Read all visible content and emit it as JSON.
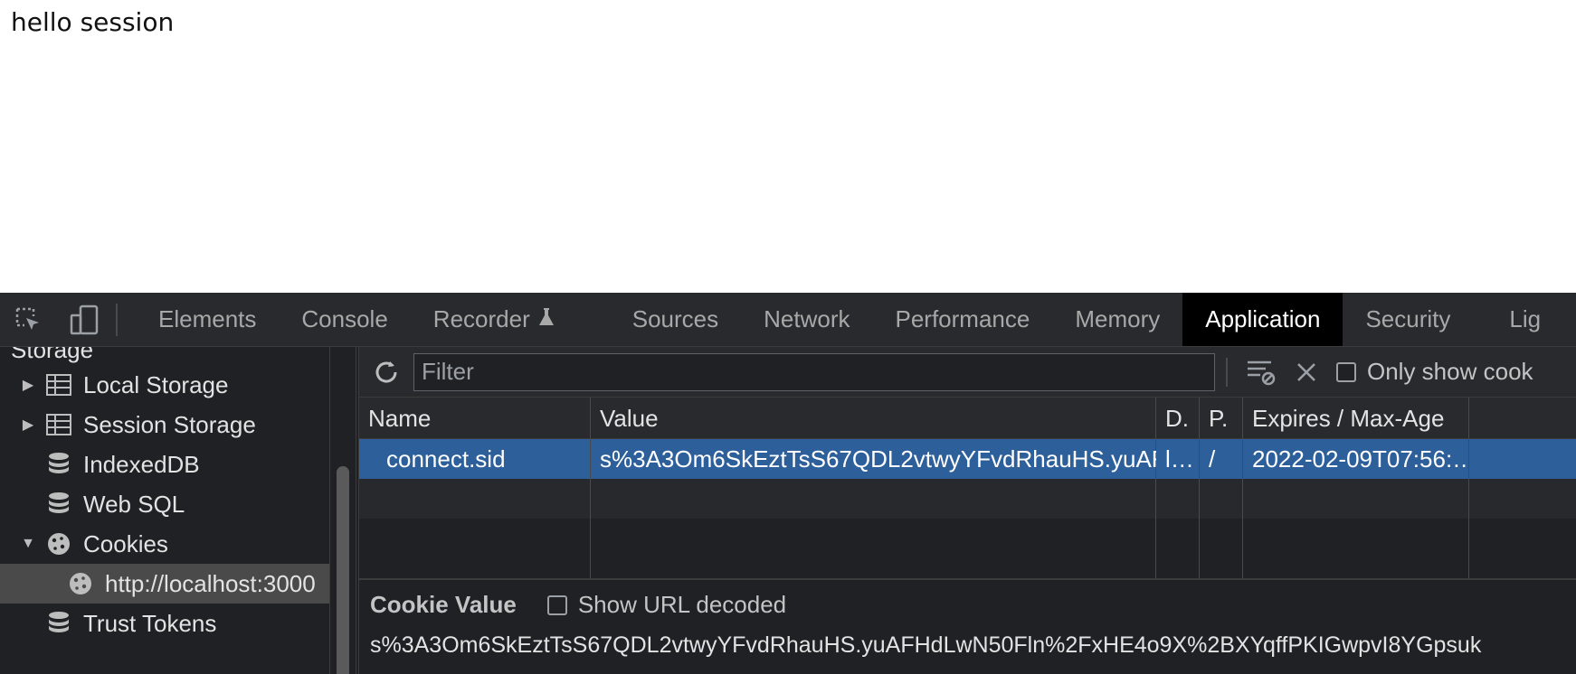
{
  "page": {
    "heading": "hello session"
  },
  "devtools": {
    "tabs": [
      {
        "label": "Elements"
      },
      {
        "label": "Console"
      },
      {
        "label": "Recorder"
      },
      {
        "label": "Sources"
      },
      {
        "label": "Network"
      },
      {
        "label": "Performance"
      },
      {
        "label": "Memory"
      },
      {
        "label": "Application"
      },
      {
        "label": "Security"
      },
      {
        "label": "Lig"
      }
    ],
    "active_tab": "Application",
    "sidebar": {
      "section_title": "Storage",
      "items": [
        {
          "label": "Local Storage",
          "icon": "table-icon",
          "expandable": true
        },
        {
          "label": "Session Storage",
          "icon": "table-icon",
          "expandable": true
        },
        {
          "label": "IndexedDB",
          "icon": "database-icon",
          "expandable": false
        },
        {
          "label": "Web SQL",
          "icon": "database-icon",
          "expandable": false
        },
        {
          "label": "Cookies",
          "icon": "cookie-icon",
          "expandable": true,
          "expanded": true
        },
        {
          "label": "http://localhost:3000",
          "icon": "cookie-icon",
          "selected": true
        },
        {
          "label": "Trust Tokens",
          "icon": "database-icon",
          "expandable": false
        }
      ]
    },
    "toolbar": {
      "filter_placeholder": "Filter",
      "only_show_label": "Only show cook"
    },
    "table": {
      "headers": {
        "name": "Name",
        "value": "Value",
        "domain": "D.",
        "path": "P.",
        "expires": "Expires / Max-Age"
      },
      "rows": [
        {
          "name": "connect.sid",
          "value": "s%3A3Om6SkEztTsS67QDL2vtwyYFvdRhauHS.yuAF…",
          "domain": "l…",
          "path": "/",
          "expires": "2022-02-09T07:56:…"
        }
      ]
    },
    "cookie_value": {
      "title": "Cookie Value",
      "show_decoded_label": "Show URL decoded",
      "value": "s%3A3Om6SkEztTsS67QDL2vtwyYFvdRhauHS.yuAFHdLwN50Fln%2FxHE4o9X%2BXYqffPKIGwpvI8YGpsuk"
    },
    "colors": {
      "selected_row": "#2d5f9a",
      "active_tab_bg": "#000000",
      "panel_bg": "#202124"
    }
  }
}
